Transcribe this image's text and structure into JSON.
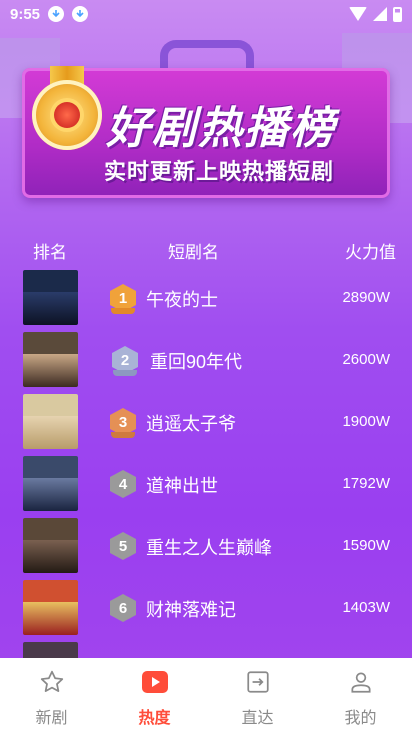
{
  "status_bar": {
    "time": "9:55"
  },
  "banner": {
    "title": "好剧热播榜",
    "subtitle": "实时更新上映热播短剧"
  },
  "list_header": {
    "rank": "排名",
    "name": "短剧名",
    "heat": "火力值"
  },
  "rows": [
    {
      "rank": "1",
      "title": "午夜的士",
      "heat": "2890W"
    },
    {
      "rank": "2",
      "title": "重回90年代",
      "heat": "2600W"
    },
    {
      "rank": "3",
      "title": "逍遥太子爷",
      "heat": "1900W"
    },
    {
      "rank": "4",
      "title": "道神出世",
      "heat": "1792W"
    },
    {
      "rank": "5",
      "title": "重生之人生巅峰",
      "heat": "1590W"
    },
    {
      "rank": "6",
      "title": "财神落难记",
      "heat": "1403W"
    }
  ],
  "colors": {
    "gold": "#f0a23a",
    "silver": "#a9b3d6",
    "bronze": "#e59055",
    "gray": "#9a9a9a",
    "active_nav": "#ff4d3a"
  },
  "nav": [
    {
      "label": "新剧",
      "icon": "star-icon"
    },
    {
      "label": "热度",
      "icon": "play-icon"
    },
    {
      "label": "直达",
      "icon": "enter-icon"
    },
    {
      "label": "我的",
      "icon": "user-icon"
    }
  ]
}
